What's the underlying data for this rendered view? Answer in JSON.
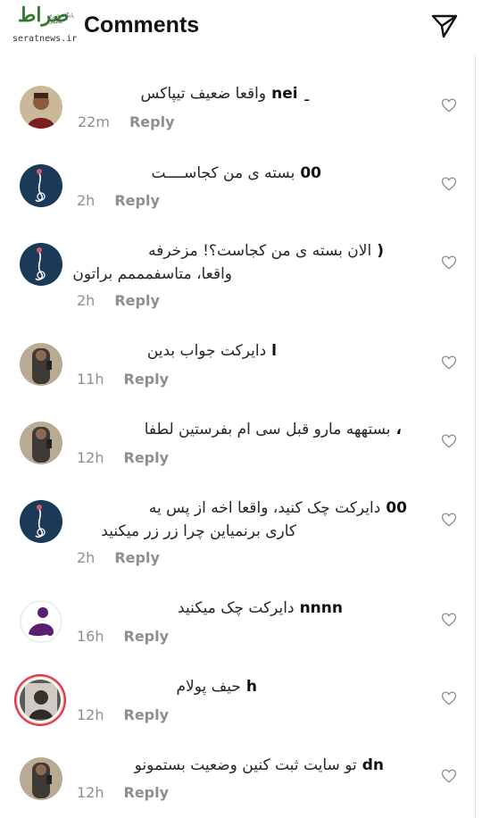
{
  "header": {
    "title": "Comments",
    "watermark_logo": "صراط",
    "watermark_sub": "پایگاه خبری تحلیلی",
    "watermark_url": "seratnews.ir"
  },
  "reply_label": "Reply",
  "comments": [
    {
      "username": "ˍ        nei",
      "text": "واقعا ضعیف تیپاکس",
      "text2": "",
      "time": "22m"
    },
    {
      "username": "00",
      "text": "بسته ی من کجاســــت",
      "text2": "",
      "time": "2h"
    },
    {
      "username": "(",
      "text": "الان بسته ی من کجاست؟! مزخرفه",
      "text2": "واقعا، متاسفمممم براتون",
      "time": "2h"
    },
    {
      "username": "ا",
      "text": "دایرکت جواب بدین",
      "text2": "",
      "time": "11h"
    },
    {
      "username": "،",
      "text": "بستههه مارو قبل سی ام بفرستین لطفا",
      "text2": "",
      "time": "12h"
    },
    {
      "username": "00",
      "text": "دایرکت چک کنید، واقعا اخه از پس یه",
      "text2": "کاری برنمیاین چرا زر زر میکنید",
      "time": "2h"
    },
    {
      "username": "nnnn",
      "text": "دایرکت چک میکنید",
      "text2": "",
      "time": "16h"
    },
    {
      "username": "h",
      "text": "حیف پولام",
      "text2": "",
      "time": "12h"
    },
    {
      "username": "dn",
      "text": "تو سایت ثبت کنین وضعیت بستمونو",
      "text2": "",
      "time": "12h"
    }
  ]
}
